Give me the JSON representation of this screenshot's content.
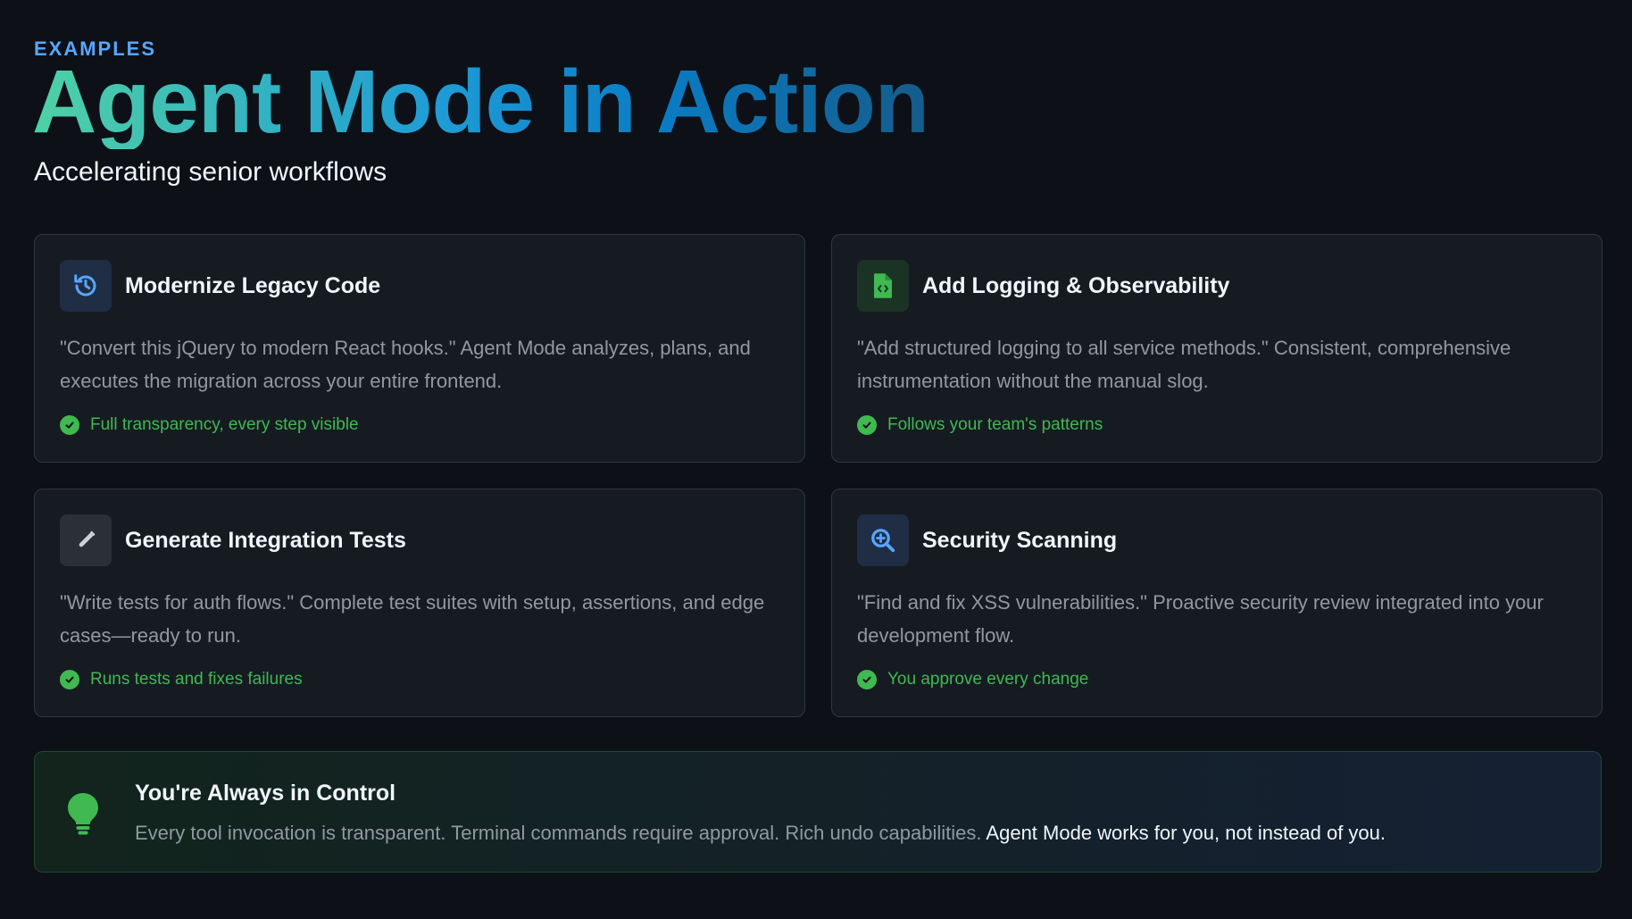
{
  "header": {
    "eyebrow": "EXAMPLES",
    "title": "Agent Mode in Action",
    "subtitle": "Accelerating senior workflows"
  },
  "cards": [
    {
      "icon": "history-icon",
      "title": "Modernize Legacy Code",
      "description": "\"Convert this jQuery to modern React hooks.\" Agent Mode analyzes, plans, and executes the migration across your entire frontend.",
      "check": "Full transparency, every step visible"
    },
    {
      "icon": "file-code-icon",
      "title": "Add Logging & Observability",
      "description": "\"Add structured logging to all service methods.\" Consistent, comprehensive instrumentation without the manual slog.",
      "check": "Follows your team's patterns"
    },
    {
      "icon": "test-tube-icon",
      "title": "Generate Integration Tests",
      "description": "\"Write tests for auth flows.\" Complete test suites with setup, assertions, and edge cases—ready to run.",
      "check": "Runs tests and fixes failures"
    },
    {
      "icon": "magnifier-plus-icon",
      "title": "Security Scanning",
      "description": "\"Find and fix XSS vulnerabilities.\" Proactive security review integrated into your development flow.",
      "check": "You approve every change"
    }
  ],
  "callout": {
    "icon": "lightbulb-icon",
    "title": "You're Always in Control",
    "body": "Every tool invocation is transparent. Terminal commands require approval. Rich undo capabilities.",
    "body_strong": "Agent Mode works for you, not instead of you."
  },
  "colors": {
    "background": "#0d1117",
    "card": "#161b22",
    "accent_blue": "#58a6ff",
    "accent_green": "#3fb950",
    "muted_text": "#9198a1"
  }
}
